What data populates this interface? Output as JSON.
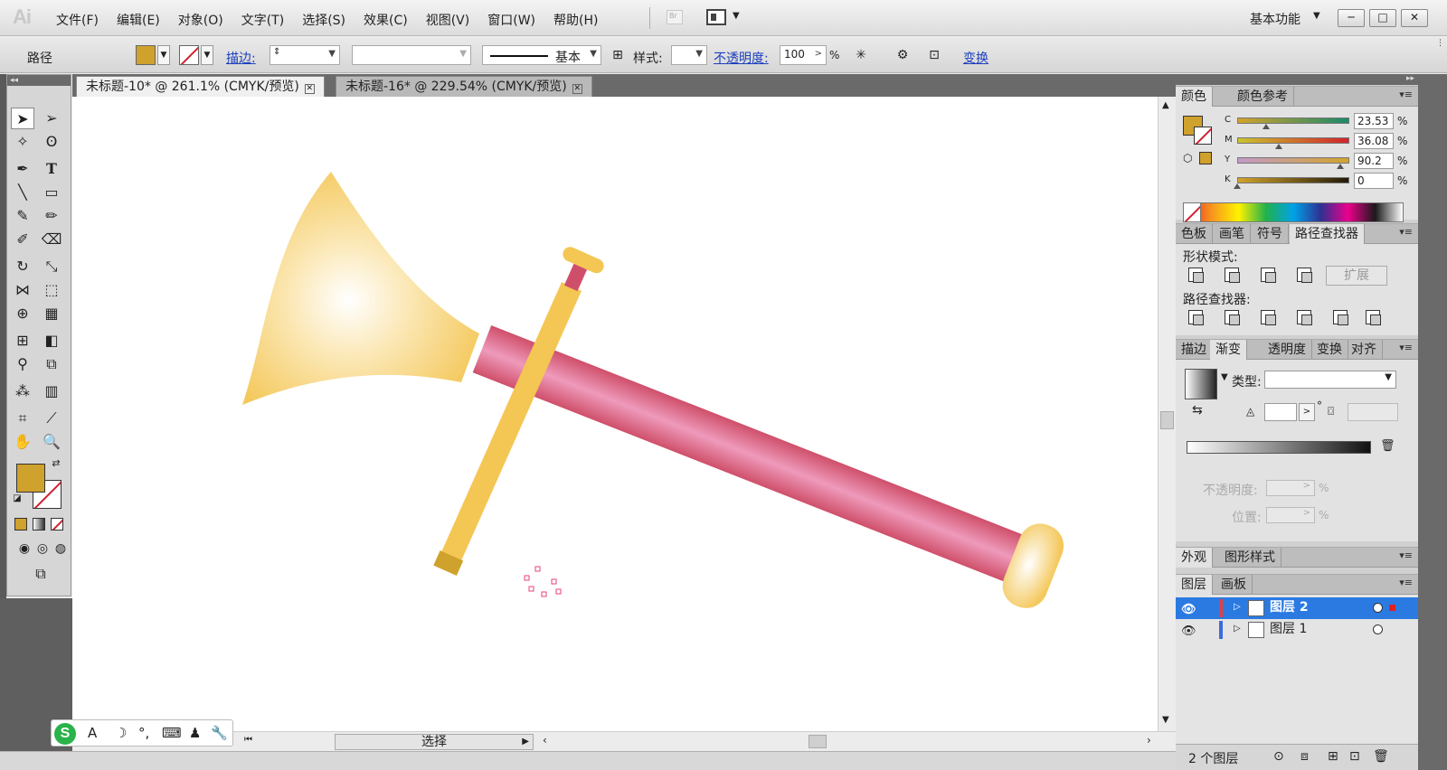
{
  "app": {
    "logo": "Ai"
  },
  "menu": [
    "文件(F)",
    "编辑(E)",
    "对象(O)",
    "文字(T)",
    "选择(S)",
    "效果(C)",
    "视图(V)",
    "窗口(W)",
    "帮助(H)"
  ],
  "bridge_label": "Br",
  "workspace": "基本功能",
  "window_controls": [
    "─",
    "□",
    "✕"
  ],
  "control_bar": {
    "object_type": "路径",
    "stroke_label": "描边:",
    "stroke_line_style": "基本",
    "style_label": "样式:",
    "opacity_label": "不透明度:",
    "opacity_value": "100",
    "opacity_unit": "%",
    "transform_label": "变换"
  },
  "tabs": [
    {
      "label": "未标题-10* @ 261.1% (CMYK/预览)",
      "active": true
    },
    {
      "label": "未标题-16* @ 229.54% (CMYK/预览)",
      "active": false
    }
  ],
  "tools": {
    "fill_color": "#cfa12d",
    "stroke_color": "none"
  },
  "color_panel": {
    "tabs": [
      "颜色",
      "颜色参考"
    ],
    "values": [
      {
        "label": "C",
        "value": "23.53",
        "unit": "%"
      },
      {
        "label": "M",
        "value": "36.08",
        "unit": "%"
      },
      {
        "label": "Y",
        "value": "90.2",
        "unit": "%"
      },
      {
        "label": "K",
        "value": "0",
        "unit": "%"
      }
    ]
  },
  "pathfinder_panel": {
    "tabs": [
      "色板",
      "画笔",
      "符号",
      "路径查找器"
    ],
    "shape_modes_label": "形状模式:",
    "expand_label": "扩展",
    "pathfinders_label": "路径查找器:"
  },
  "gradient_panel": {
    "tabs": [
      "描边",
      "渐变",
      "透明度",
      "变换",
      "对齐"
    ],
    "type_label": "类型:",
    "degree_symbol": "°",
    "opacity_label": "不透明度:",
    "position_label": "位置:",
    "percent": "%"
  },
  "appearance_panel": {
    "tabs": [
      "外观",
      "图形样式"
    ]
  },
  "layers_panel": {
    "tabs": [
      "图层",
      "画板"
    ],
    "layers": [
      {
        "name": "图层 2",
        "selected": true,
        "color": "#e04040"
      },
      {
        "name": "图层 1",
        "selected": false,
        "color": "#3a6be0"
      }
    ],
    "count_label": "2 个图层"
  },
  "status": {
    "tool_label": "选择"
  },
  "ime": {
    "logo": "S",
    "items": [
      "A",
      "☽",
      "°,",
      "⌨",
      "♟",
      "🔧"
    ]
  },
  "colors": {
    "trumpet_gold": "#f5c95a",
    "tube_pink": "#d45a73",
    "tube_highlight": "#ef98b8",
    "accent_blue": "#2a7ae2"
  }
}
